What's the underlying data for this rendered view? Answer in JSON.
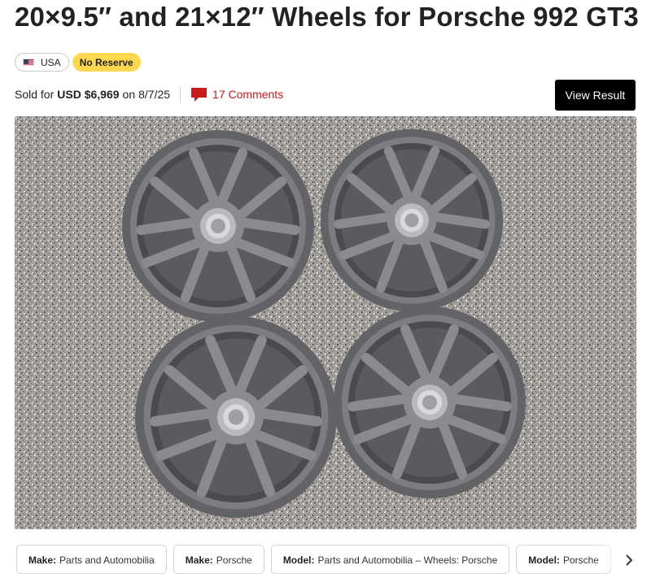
{
  "listing": {
    "title": "20×9.5″ and 21×12″ Wheels for Porsche 992 GT3",
    "badges": {
      "country": "USA",
      "reserve": "No Reserve"
    },
    "sold": {
      "prefix": "Sold for",
      "price": "USD $6,969",
      "on": "on",
      "date": "8/7/25"
    },
    "comments": "17 Comments",
    "view_result": "View Result"
  },
  "chips": [
    {
      "key": "Make:",
      "value": "Parts and Automobilia"
    },
    {
      "key": "Make:",
      "value": "Porsche"
    },
    {
      "key": "Model:",
      "value": "Parts and Automobilia – Wheels: Porsche"
    },
    {
      "key": "Model:",
      "value": "Porsche"
    }
  ],
  "colors": {
    "accent": "#c81b1b",
    "reserve_badge": "#ffd84f",
    "button": "#000000",
    "wheel": "#6f7073"
  },
  "icons": {
    "flag": "us-flag-icon",
    "comments": "comment-bubble-icon",
    "next": "chevron-right-icon"
  }
}
